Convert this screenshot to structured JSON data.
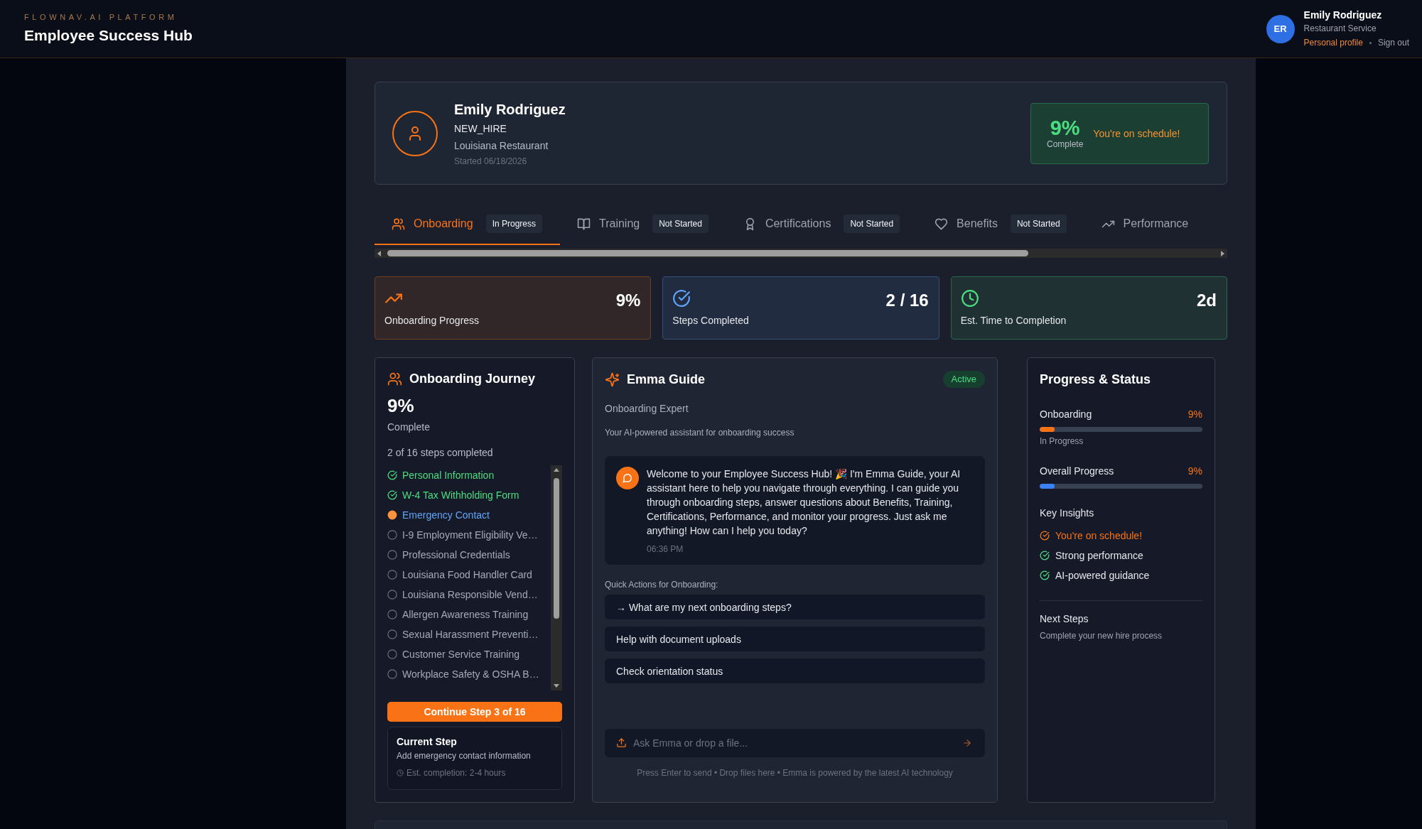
{
  "header": {
    "kicker": "FLOWNAV.AI PLATFORM",
    "title": "Employee Success Hub",
    "user": {
      "initials": "ER",
      "name": "Emily Rodriguez",
      "role": "Restaurant Service",
      "links": [
        {
          "label": "Personal profile",
          "kind": "accent"
        },
        {
          "label": "Sign out",
          "kind": "plain"
        }
      ]
    }
  },
  "profile": {
    "name": "Emily Rodriguez",
    "status": "NEW_HIRE",
    "location": "Louisiana Restaurant",
    "started": "Started 06/18/2026",
    "progress": {
      "percent": "9%",
      "caption": "Complete",
      "message": "You're on schedule!"
    }
  },
  "tabs": [
    {
      "label": "Onboarding",
      "selected": true,
      "badge": "In Progress"
    },
    {
      "label": "Training",
      "selected": false,
      "badge": "Not Started"
    },
    {
      "label": "Certifications",
      "selected": false,
      "badge": "Not Started"
    },
    {
      "label": "Benefits",
      "selected": false,
      "badge": "Not Started"
    },
    {
      "label": "Performance",
      "selected": false
    }
  ],
  "stats": [
    {
      "value": "9%",
      "label": "Onboarding Progress",
      "color": "#f97316"
    },
    {
      "value": "2 / 16",
      "label": "Steps Completed",
      "color": "#60a5fa"
    },
    {
      "value": "2d",
      "label": "Est. Time to Completion",
      "color": "#4ade80"
    }
  ],
  "journey": {
    "title": "Onboarding Journey",
    "percent": "9%",
    "caption": "Complete",
    "summary": "2 of 16 steps completed",
    "steps": [
      {
        "label": "Personal Information",
        "kind": "done"
      },
      {
        "label": "W-4 Tax Withholding Form",
        "kind": "done"
      },
      {
        "label": "Emergency Contact",
        "kind": "current"
      },
      {
        "label": "I-9 Employment Eligibility Ve…",
        "kind": "todo"
      },
      {
        "label": "Professional Credentials",
        "kind": "todo"
      },
      {
        "label": "Louisiana Food Handler Card",
        "kind": "todo"
      },
      {
        "label": "Louisiana Responsible Vend…",
        "kind": "todo"
      },
      {
        "label": "Allergen Awareness Training",
        "kind": "todo"
      },
      {
        "label": "Sexual Harassment Preventi…",
        "kind": "todo"
      },
      {
        "label": "Customer Service Training",
        "kind": "todo"
      },
      {
        "label": "Workplace Safety & OSHA B…",
        "kind": "todo"
      }
    ],
    "button": "Continue Step 3 of 16",
    "current_step": {
      "title": "Current Step",
      "description": "Add emergency contact information",
      "estimate": "Est. completion: 2-4 hours"
    }
  },
  "emma": {
    "title": "Emma Guide",
    "status": "Active",
    "subtitle": "Onboarding Expert",
    "description": "Your AI-powered assistant for onboarding success",
    "messages": [
      {
        "text": "Welcome to your Employee Success Hub! 🎉 I'm Emma Guide, your AI assistant here to help you navigate through everything. I can guide you through onboarding steps, answer questions about Benefits, Training, Certifications, Performance, and monitor your progress. Just ask me anything! How can I help you today?",
        "time": "06:36 PM"
      }
    ],
    "quick_actions_label": "Quick Actions for Onboarding:",
    "quick_actions": [
      "→ What are my next onboarding steps?",
      "Help with document uploads",
      "Check orientation status"
    ],
    "input": {
      "placeholder": "Ask Emma or drop a file..."
    },
    "footnote": "Press Enter to send • Drop files here • Emma is powered by the latest AI technology"
  },
  "progress": {
    "title": "Progress & Status",
    "bars": [
      {
        "label": "Onboarding",
        "value": "9%",
        "level": 0.09,
        "note": "In Progress",
        "color": "#f97316"
      },
      {
        "label": "Overall Progress",
        "value": "9%",
        "level": 0.09,
        "color": "#3b82f6"
      }
    ],
    "insights_title": "Key Insights",
    "insights": [
      {
        "label": "You're on schedule!",
        "color": "#f97316",
        "highlighted": true
      },
      {
        "label": "Strong performance",
        "color": "#4ade80",
        "highlighted": false
      },
      {
        "label": "AI-powered guidance",
        "color": "#4ade80",
        "highlighted": false
      }
    ],
    "next_title": "Next Steps",
    "next_text": "Complete your new hire process"
  }
}
